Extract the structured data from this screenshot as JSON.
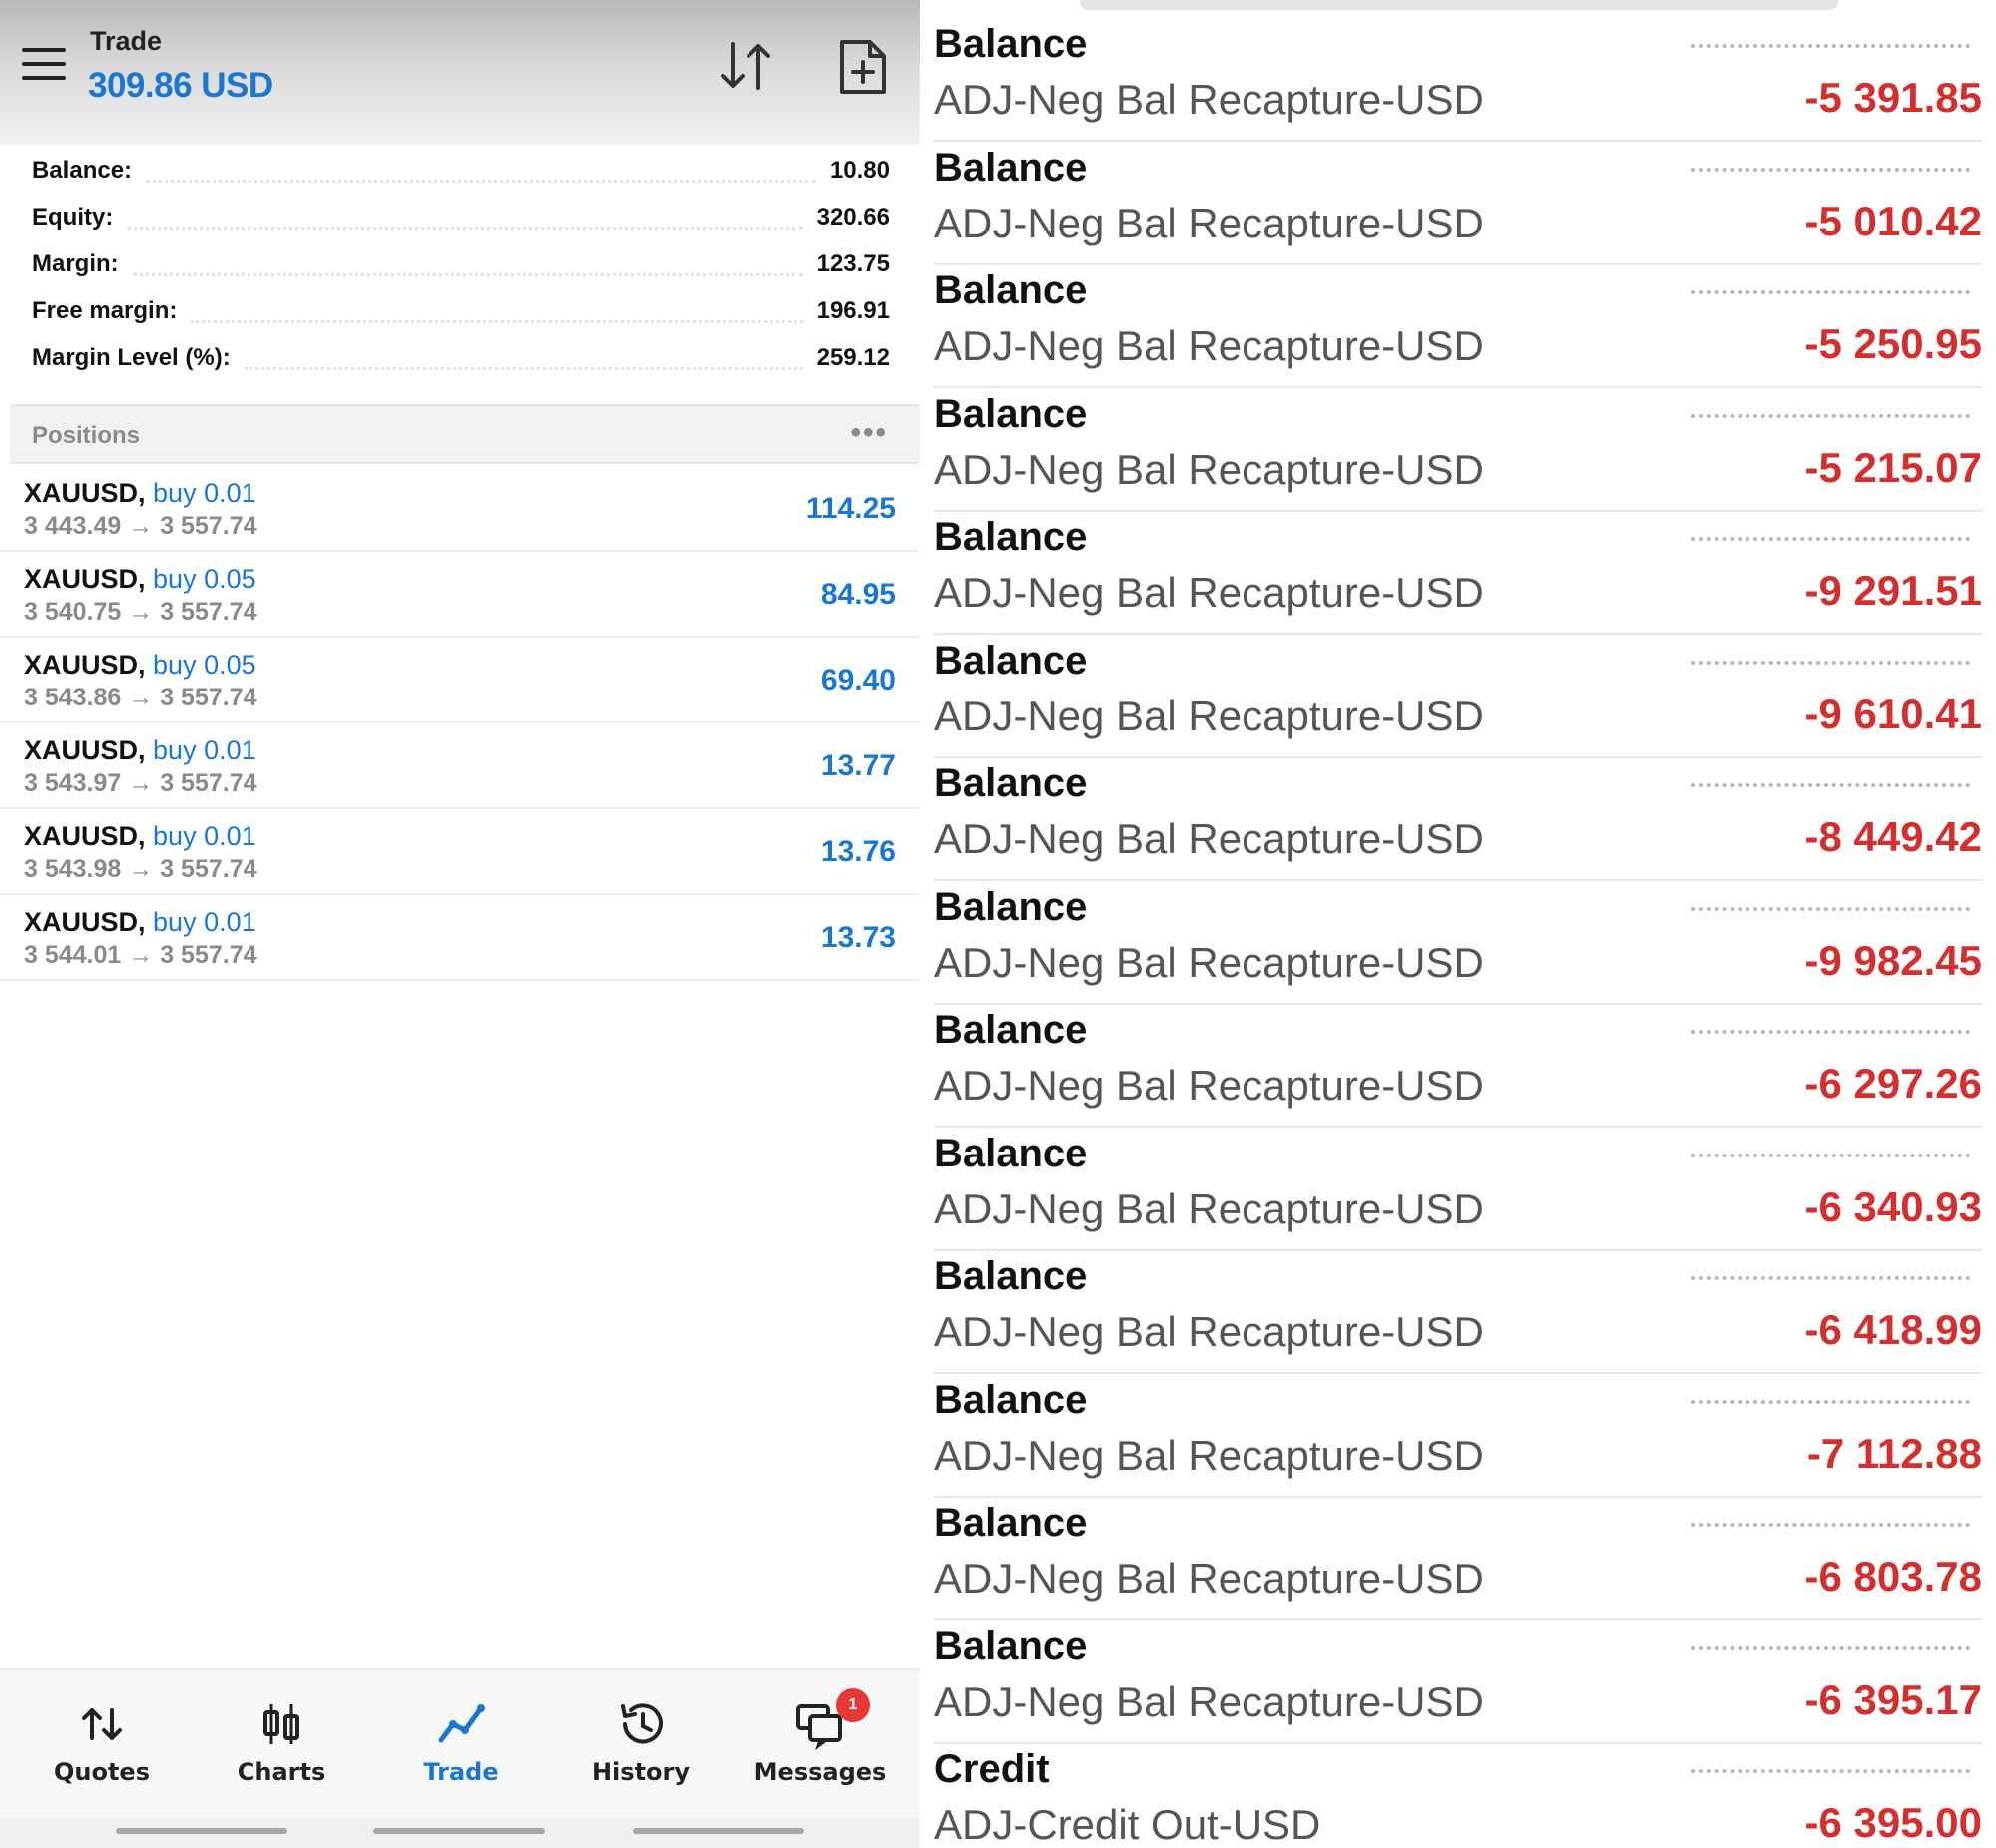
{
  "header": {
    "title": "Trade",
    "amount": "309.86 USD",
    "icons": [
      "menu-icon",
      "sort-icon",
      "new-order-icon"
    ]
  },
  "summary": [
    {
      "label": "Balance:",
      "value": "10.80"
    },
    {
      "label": "Equity:",
      "value": "320.66"
    },
    {
      "label": "Margin:",
      "value": "123.75"
    },
    {
      "label": "Free margin:",
      "value": "196.91"
    },
    {
      "label": "Margin Level (%):",
      "value": "259.12"
    }
  ],
  "positions": {
    "label": "Positions",
    "more": "•••",
    "items": [
      {
        "symbol": "XAUUSD,",
        "direction": "buy 0.01",
        "prices": "3 443.49 → 3 557.74",
        "profit": "114.25"
      },
      {
        "symbol": "XAUUSD,",
        "direction": "buy 0.05",
        "prices": "3 540.75 → 3 557.74",
        "profit": "84.95"
      },
      {
        "symbol": "XAUUSD,",
        "direction": "buy 0.05",
        "prices": "3 543.86 → 3 557.74",
        "profit": "69.40"
      },
      {
        "symbol": "XAUUSD,",
        "direction": "buy 0.01",
        "prices": "3 543.97 → 3 557.74",
        "profit": "13.77"
      },
      {
        "symbol": "XAUUSD,",
        "direction": "buy 0.01",
        "prices": "3 543.98 → 3 557.74",
        "profit": "13.76"
      },
      {
        "symbol": "XAUUSD,",
        "direction": "buy 0.01",
        "prices": "3 544.01 → 3 557.74",
        "profit": "13.73"
      }
    ]
  },
  "nav": {
    "items": [
      {
        "label": "Quotes",
        "icon": "quotes-icon"
      },
      {
        "label": "Charts",
        "icon": "charts-icon"
      },
      {
        "label": "Trade",
        "icon": "trade-icon"
      },
      {
        "label": "History",
        "icon": "history-icon"
      },
      {
        "label": "Messages",
        "icon": "messages-icon"
      }
    ],
    "active": "Trade",
    "badge": "1"
  },
  "history": [
    {
      "type": "Balance",
      "comment": "ADJ-Neg Bal Recapture-USD",
      "amount": "-5 391.85"
    },
    {
      "type": "Balance",
      "comment": "ADJ-Neg Bal Recapture-USD",
      "amount": "-5 010.42"
    },
    {
      "type": "Balance",
      "comment": "ADJ-Neg Bal Recapture-USD",
      "amount": "-5 250.95"
    },
    {
      "type": "Balance",
      "comment": "ADJ-Neg Bal Recapture-USD",
      "amount": "-5 215.07"
    },
    {
      "type": "Balance",
      "comment": "ADJ-Neg Bal Recapture-USD",
      "amount": "-9 291.51"
    },
    {
      "type": "Balance",
      "comment": "ADJ-Neg Bal Recapture-USD",
      "amount": "-9 610.41"
    },
    {
      "type": "Balance",
      "comment": "ADJ-Neg Bal Recapture-USD",
      "amount": "-8 449.42"
    },
    {
      "type": "Balance",
      "comment": "ADJ-Neg Bal Recapture-USD",
      "amount": "-9 982.45"
    },
    {
      "type": "Balance",
      "comment": "ADJ-Neg Bal Recapture-USD",
      "amount": "-6 297.26"
    },
    {
      "type": "Balance",
      "comment": "ADJ-Neg Bal Recapture-USD",
      "amount": "-6 340.93"
    },
    {
      "type": "Balance",
      "comment": "ADJ-Neg Bal Recapture-USD",
      "amount": "-6 418.99"
    },
    {
      "type": "Balance",
      "comment": "ADJ-Neg Bal Recapture-USD",
      "amount": "-7 112.88"
    },
    {
      "type": "Balance",
      "comment": "ADJ-Neg Bal Recapture-USD",
      "amount": "-6 803.78"
    },
    {
      "type": "Balance",
      "comment": "ADJ-Neg Bal Recapture-USD",
      "amount": "-6 395.17"
    },
    {
      "type": "Credit",
      "comment": "ADJ-Credit Out-USD",
      "amount": "-6 395.00"
    }
  ],
  "colors": {
    "accent": "#1976d2",
    "negative": "#d32f2f",
    "badge": "#e53935"
  }
}
